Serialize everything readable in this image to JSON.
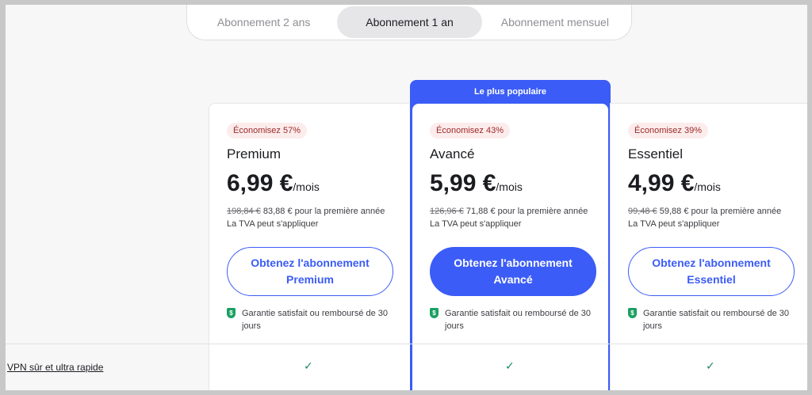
{
  "tabs": [
    {
      "label": "Abonnement 2 ans"
    },
    {
      "label": "Abonnement 1 an"
    },
    {
      "label": "Abonnement mensuel"
    }
  ],
  "featured_banner": "Le plus populaire",
  "plans": [
    {
      "badge": "Économisez 57%",
      "name": "Premium",
      "price": "6,99 €",
      "unit": "/mois",
      "old_price": "198,84 €",
      "new_price_text": "83,88 € pour la première année",
      "vat": "La TVA peut s'appliquer",
      "cta": "Obtenez l'abonnement Premium",
      "guarantee": "Garantie satisfait ou remboursé de 30 jours"
    },
    {
      "badge": "Économisez 43%",
      "name": "Avancé",
      "price": "5,99 €",
      "unit": "/mois",
      "old_price": "126,96 €",
      "new_price_text": "71,88 € pour la première année",
      "vat": "La TVA peut s'appliquer",
      "cta": "Obtenez l'abonnement Avancé",
      "guarantee": "Garantie satisfait ou remboursé de 30 jours"
    },
    {
      "badge": "Économisez 39%",
      "name": "Essentiel",
      "price": "4,99 €",
      "unit": "/mois",
      "old_price": "99,48 €",
      "new_price_text": "59,88 € pour la première année",
      "vat": "La TVA peut s'appliquer",
      "cta": "Obtenez l'abonnement Essentiel",
      "guarantee": "Garantie satisfait ou remboursé de 30 jours"
    }
  ],
  "features": [
    {
      "label": "VPN sûr et ultra rapide",
      "check": "✓"
    }
  ],
  "colors": {
    "accent": "#3b5cf6",
    "badge_bg": "#fdecec",
    "badge_text": "#9c2a2a",
    "check": "#1a8a5a",
    "shield": "#1aa062"
  }
}
